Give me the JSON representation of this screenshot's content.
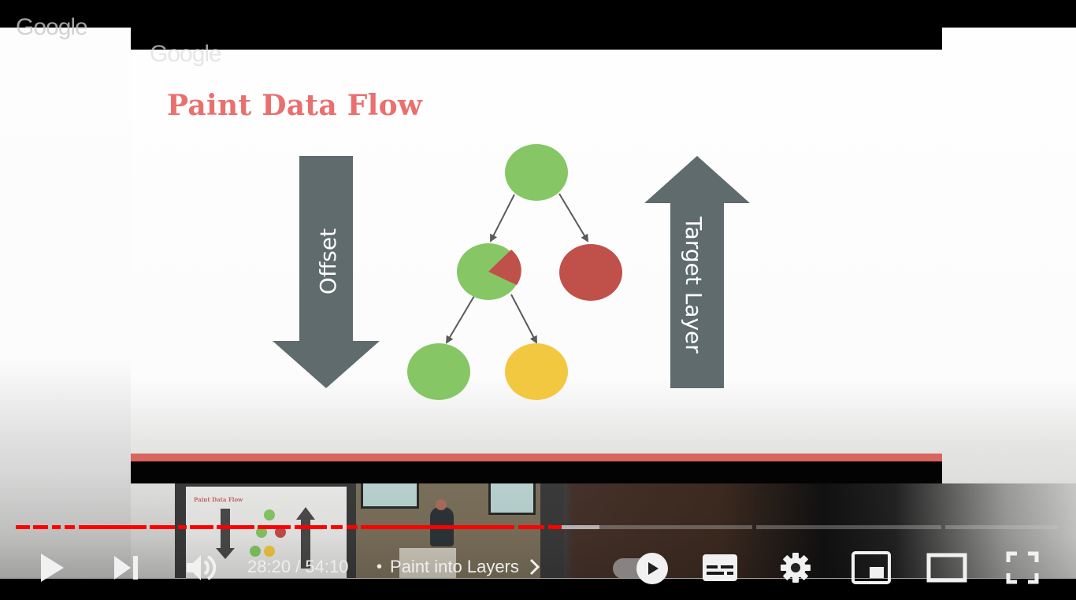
{
  "video": {
    "watermark": "Google",
    "slide": {
      "title": "Paint Data Flow",
      "left_arrow_label": "Offset",
      "right_arrow_label": "Target Layer",
      "title_color": "#e9706e",
      "arrow_color": "#5f6b6d",
      "footer_color": "#d9655f",
      "nodes": [
        {
          "id": "root",
          "color": "#86c664"
        },
        {
          "id": "left-child",
          "color": "#86c664",
          "slice_color": "#c0504a"
        },
        {
          "id": "right-child",
          "color": "#c0504a"
        },
        {
          "id": "left-grandchild",
          "color": "#86c664"
        },
        {
          "id": "right-grandchild",
          "color": "#f2c840"
        }
      ]
    },
    "storyboard": {
      "thumbnail_title": "Paint Data Flow"
    }
  },
  "player": {
    "current_time": "28:20",
    "duration": "54:10",
    "time_separator": " / ",
    "chapter_separator": "•",
    "chapter_title": "Paint into Layers",
    "progress_fraction": 0.523,
    "accent_color": "#ff0000",
    "controls": {
      "play": "play-icon",
      "next": "next-icon",
      "volume": "volume-icon",
      "autoplay": "autoplay-toggle",
      "subtitles": "subtitles-icon",
      "settings": "gear-icon",
      "miniplayer": "miniplayer-icon",
      "theater": "theater-icon",
      "fullscreen": "fullscreen-icon"
    },
    "autoplay_on": true
  }
}
